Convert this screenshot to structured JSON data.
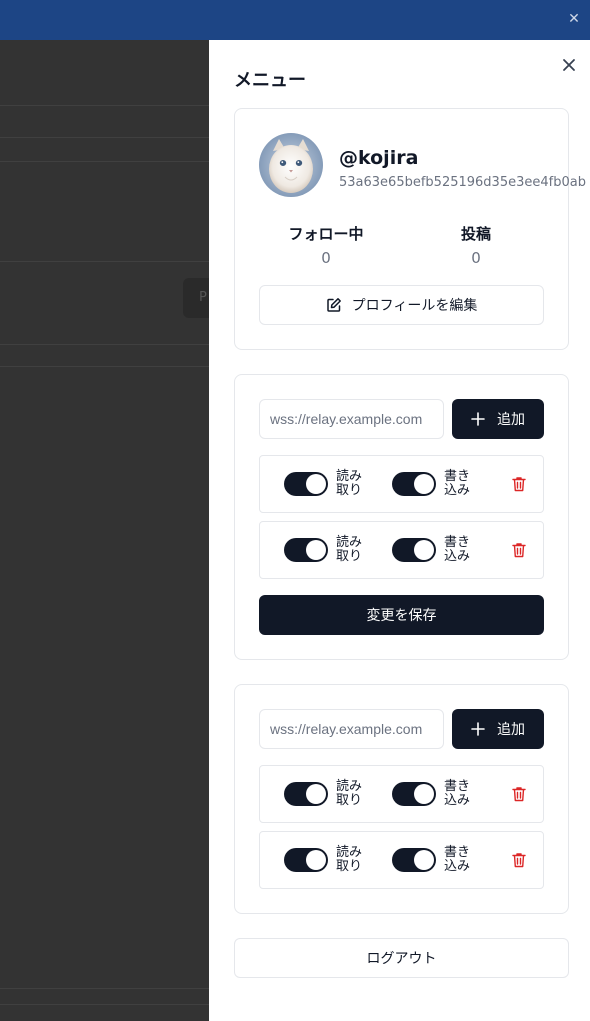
{
  "background": {
    "button_label": "P"
  },
  "drawer": {
    "title": "メニュー",
    "close_icon": "close-icon"
  },
  "profile": {
    "username": "@kojira",
    "pubkey": "53a63e65befb525196d35e3ee4fb0ab",
    "following_label": "フォロー中",
    "following_count": "0",
    "posts_label": "投稿",
    "posts_count": "0",
    "edit_label": "プロフィールを編集",
    "edit_icon": "edit-icon"
  },
  "relay_sections": [
    {
      "input_placeholder": "wss://relay.example.com",
      "add_label": "追加",
      "rows": [
        {
          "read_label": "読み取り",
          "write_label": "書き込み",
          "read_on": true,
          "write_on": true
        },
        {
          "read_label": "読み取り",
          "write_label": "書き込み",
          "read_on": true,
          "write_on": true
        }
      ],
      "save_label": "変更を保存"
    },
    {
      "input_placeholder": "wss://relay.example.com",
      "add_label": "追加",
      "rows": [
        {
          "read_label": "読み取り",
          "write_label": "書き込み",
          "read_on": true,
          "write_on": true
        },
        {
          "read_label": "読み取り",
          "write_label": "書き込み",
          "read_on": true,
          "write_on": true
        }
      ]
    }
  ],
  "logout_label": "ログアウト",
  "colors": {
    "topbar": "#1d4585",
    "primary": "#111827",
    "danger": "#dc2626",
    "border": "#e5e7eb"
  }
}
